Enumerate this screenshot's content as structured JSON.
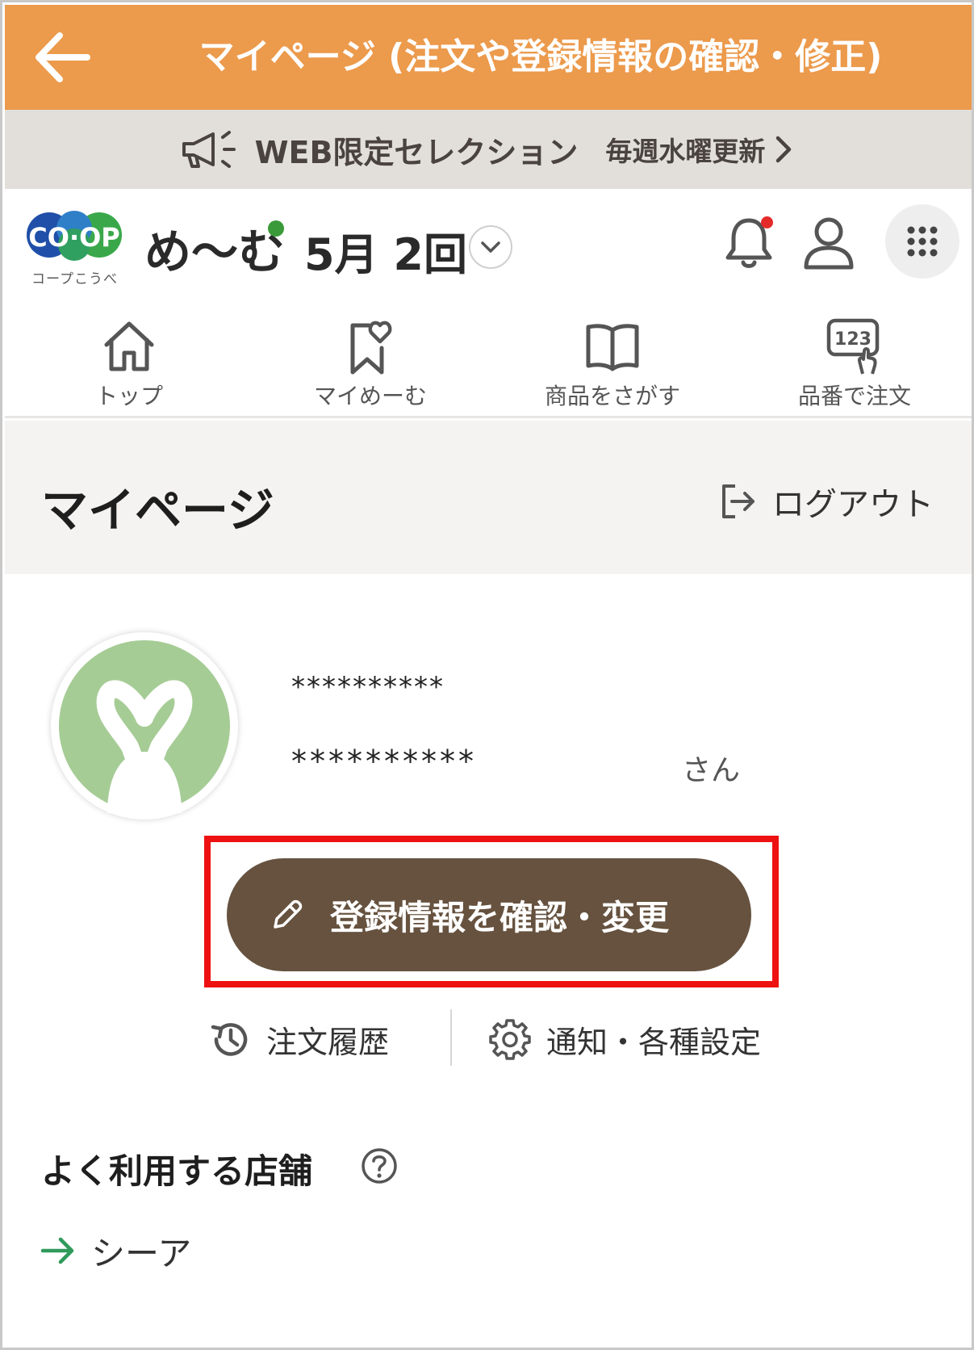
{
  "header": {
    "title": "マイページ (注文や登録情報の確認・修正)",
    "back_icon": "arrow-left-icon",
    "bg_color": "#ec9a4c"
  },
  "announcement": {
    "main": "WEB限定セレクション",
    "sub": "毎週水曜更新",
    "icon": "megaphone-icon"
  },
  "brand": {
    "logo_sub": "コープこうべ",
    "name": "め〜む",
    "delivery": "5月 2回"
  },
  "tabs": [
    {
      "label": "トップ",
      "icon": "home-icon"
    },
    {
      "label": "マイめーむ",
      "icon": "bookmark-heart-icon"
    },
    {
      "label": "商品をさがす",
      "icon": "book-icon"
    },
    {
      "label": "品番で注文",
      "icon": "number-touch-icon"
    }
  ],
  "page": {
    "title": "マイページ",
    "logout_label": "ログアウト"
  },
  "profile": {
    "user_id": "**********",
    "user_name": "**********",
    "honorific": "さん"
  },
  "actions": {
    "edit_label": "登録情報を確認・変更",
    "order_history": "注文履歴",
    "settings": "通知・各種設定",
    "button_color": "#66523f",
    "highlight_color": "#ee1111"
  },
  "store": {
    "title": "よく利用する店舗",
    "name": "シーア"
  }
}
